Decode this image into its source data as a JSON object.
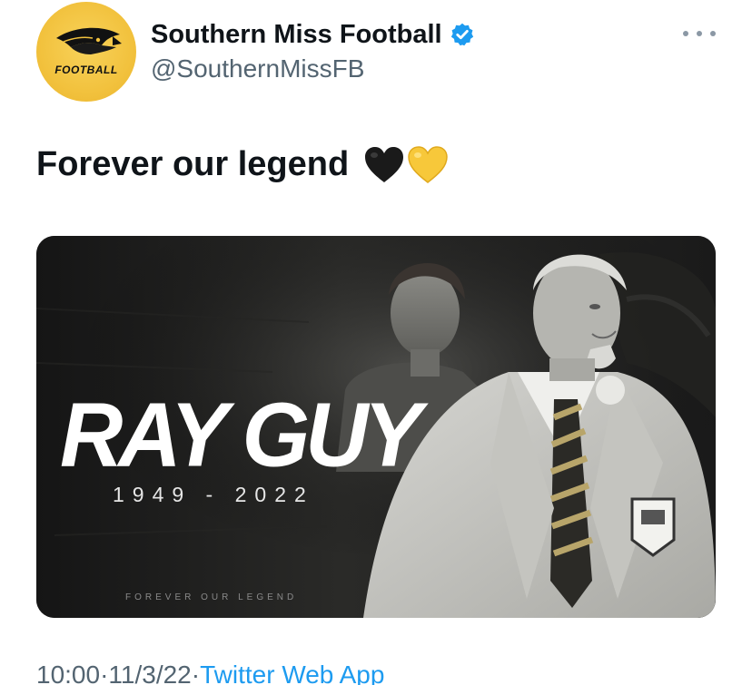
{
  "tweet": {
    "author": {
      "display_name": "Southern Miss Football",
      "handle": "@SouthernMissFB",
      "avatar_text": "FOOTBALL",
      "verified_icon": "verified-badge-icon",
      "avatar_icon": "golden-eagle-logo"
    },
    "more_icon": "more-options-icon",
    "text": "Forever our legend",
    "emojis": [
      "black-heart",
      "yellow-heart"
    ],
    "media": {
      "headline": "RAY GUY",
      "years": "1949 - 2022",
      "tagline": "FOREVER OUR LEGEND"
    },
    "meta": {
      "time": "10:00",
      "separator": " · ",
      "date": "11/3/22",
      "source": "Twitter Web App"
    }
  },
  "colors": {
    "text_primary": "#0f1419",
    "text_secondary": "#536471",
    "link_blue": "#1d9bf0",
    "avatar_gold": "#f2c23e"
  }
}
